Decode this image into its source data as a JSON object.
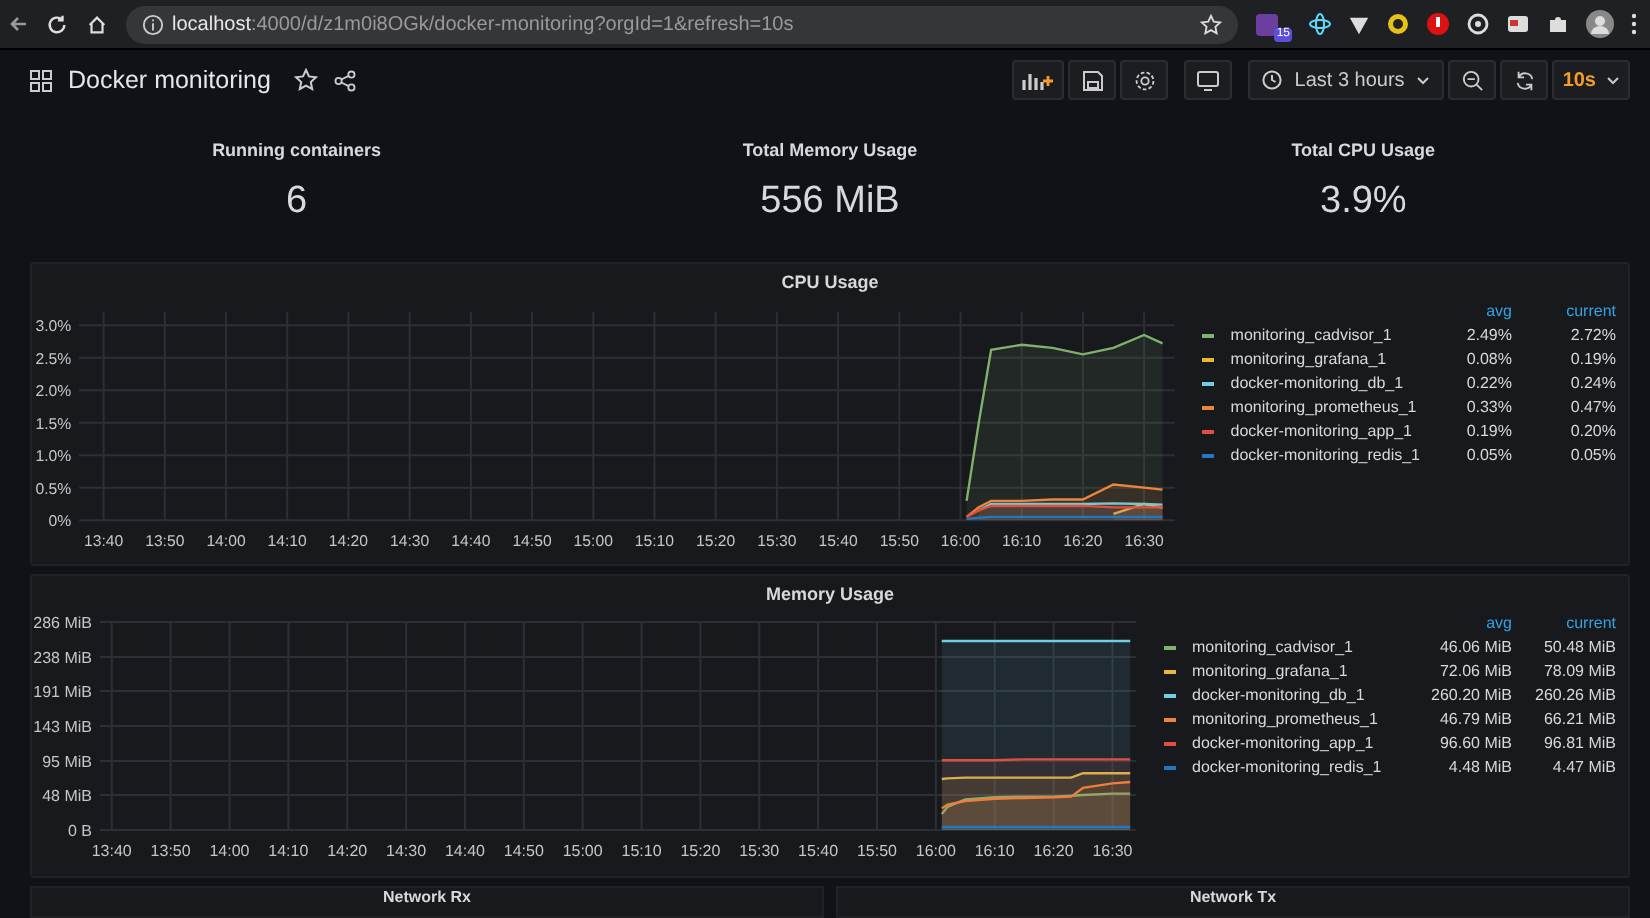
{
  "browser": {
    "url_host": "localhost",
    "url_path": ":4000/d/z1m0i8OGk/docker-monitoring?orgId=1&refresh=10s",
    "extension_badge": "15"
  },
  "dashboard": {
    "title": "Docker monitoring",
    "time_range": "Last 3 hours",
    "refresh": "10s"
  },
  "stats": [
    {
      "title": "Running containers",
      "value": "6"
    },
    {
      "title": "Total Memory Usage",
      "value": "556 MiB"
    },
    {
      "title": "Total CPU Usage",
      "value": "3.9%"
    }
  ],
  "panels": [
    {
      "title": "CPU Usage",
      "legend_columns": [
        "avg",
        "current"
      ],
      "legend": [
        {
          "avg": "2.49%",
          "current": "2.72%"
        },
        {
          "avg": "0.08%",
          "current": "0.19%"
        },
        {
          "avg": "0.22%",
          "current": "0.24%"
        },
        {
          "avg": "0.33%",
          "current": "0.47%"
        },
        {
          "avg": "0.19%",
          "current": "0.20%"
        },
        {
          "avg": "0.05%",
          "current": "0.05%"
        }
      ],
      "chart_data": {
        "type": "area",
        "grid": true,
        "x": [
          961,
          963,
          965,
          970,
          975,
          980,
          985,
          990,
          993
        ],
        "xlim": [
          816,
          995
        ],
        "ylim": [
          0,
          3.2
        ],
        "xticks": [
          {
            "value": 820,
            "label": "13:40"
          },
          {
            "value": 830,
            "label": "13:50"
          },
          {
            "value": 840,
            "label": "14:00"
          },
          {
            "value": 850,
            "label": "14:10"
          },
          {
            "value": 860,
            "label": "14:20"
          },
          {
            "value": 870,
            "label": "14:30"
          },
          {
            "value": 880,
            "label": "14:40"
          },
          {
            "value": 890,
            "label": "14:50"
          },
          {
            "value": 900,
            "label": "15:00"
          },
          {
            "value": 910,
            "label": "15:10"
          },
          {
            "value": 920,
            "label": "15:20"
          },
          {
            "value": 930,
            "label": "15:30"
          },
          {
            "value": 940,
            "label": "15:40"
          },
          {
            "value": 950,
            "label": "15:50"
          },
          {
            "value": 960,
            "label": "16:00"
          },
          {
            "value": 970,
            "label": "16:10"
          },
          {
            "value": 980,
            "label": "16:20"
          },
          {
            "value": 990,
            "label": "16:30"
          }
        ],
        "yticks": [
          {
            "value": 0,
            "label": "0%"
          },
          {
            "value": 0.5,
            "label": "0.5%"
          },
          {
            "value": 1,
            "label": "1.0%"
          },
          {
            "value": 1.5,
            "label": "1.5%"
          },
          {
            "value": 2,
            "label": "2.0%"
          },
          {
            "value": 2.5,
            "label": "2.5%"
          },
          {
            "value": 3,
            "label": "3.0%"
          }
        ],
        "series": [
          {
            "name": "monitoring_cadvisor_1",
            "color": "#7eb26d",
            "values": [
              0.3,
              1.5,
              2.62,
              2.7,
              2.65,
              2.55,
              2.65,
              2.85,
              2.72
            ]
          },
          {
            "name": "monitoring_grafana_1",
            "color": "#eab839",
            "values": [
              null,
              null,
              null,
              null,
              null,
              null,
              0.1,
              0.25,
              0.19
            ]
          },
          {
            "name": "docker-monitoring_db_1",
            "color": "#6ed0e0",
            "values": [
              null,
              0.15,
              0.25,
              0.25,
              0.25,
              0.25,
              0.26,
              0.25,
              0.24
            ]
          },
          {
            "name": "monitoring_prometheus_1",
            "color": "#ef843c",
            "values": [
              0.05,
              0.2,
              0.3,
              0.3,
              0.32,
              0.32,
              0.55,
              0.5,
              0.47
            ]
          },
          {
            "name": "docker-monitoring_app_1",
            "color": "#e24d42",
            "values": [
              0.05,
              0.15,
              0.22,
              0.22,
              0.22,
              0.22,
              0.2,
              0.2,
              0.2
            ]
          },
          {
            "name": "docker-monitoring_redis_1",
            "color": "#1f78c1",
            "values": [
              0.02,
              0.04,
              0.05,
              0.05,
              0.05,
              0.05,
              0.05,
              0.05,
              0.05
            ]
          }
        ]
      }
    },
    {
      "title": "Memory Usage",
      "legend_columns": [
        "avg",
        "current"
      ],
      "legend": [
        {
          "avg": "46.06 MiB",
          "current": "50.48 MiB"
        },
        {
          "avg": "72.06 MiB",
          "current": "78.09 MiB"
        },
        {
          "avg": "260.20 MiB",
          "current": "260.26 MiB"
        },
        {
          "avg": "46.79 MiB",
          "current": "66.21 MiB"
        },
        {
          "avg": "96.60 MiB",
          "current": "96.81 MiB"
        },
        {
          "avg": "4.48 MiB",
          "current": "4.47 MiB"
        }
      ],
      "chart_data": {
        "type": "area",
        "grid": true,
        "x": [
          961,
          962,
          965,
          970,
          975,
          980,
          983,
          985,
          990,
          993
        ],
        "xlim": [
          818,
          994
        ],
        "ylim": [
          0,
          286
        ],
        "xticks": [
          {
            "value": 820,
            "label": "13:40"
          },
          {
            "value": 830,
            "label": "13:50"
          },
          {
            "value": 840,
            "label": "14:00"
          },
          {
            "value": 850,
            "label": "14:10"
          },
          {
            "value": 860,
            "label": "14:20"
          },
          {
            "value": 870,
            "label": "14:30"
          },
          {
            "value": 880,
            "label": "14:40"
          },
          {
            "value": 890,
            "label": "14:50"
          },
          {
            "value": 900,
            "label": "15:00"
          },
          {
            "value": 910,
            "label": "15:10"
          },
          {
            "value": 920,
            "label": "15:20"
          },
          {
            "value": 930,
            "label": "15:30"
          },
          {
            "value": 940,
            "label": "15:40"
          },
          {
            "value": 950,
            "label": "15:50"
          },
          {
            "value": 960,
            "label": "16:00"
          },
          {
            "value": 970,
            "label": "16:10"
          },
          {
            "value": 980,
            "label": "16:20"
          },
          {
            "value": 990,
            "label": "16:30"
          }
        ],
        "yticks": [
          {
            "value": 0,
            "label": "0 B"
          },
          {
            "value": 48,
            "label": "48 MiB"
          },
          {
            "value": 95,
            "label": "95 MiB"
          },
          {
            "value": 143,
            "label": "143 MiB"
          },
          {
            "value": 191,
            "label": "191 MiB"
          },
          {
            "value": 238,
            "label": "238 MiB"
          },
          {
            "value": 286,
            "label": "286 MiB"
          }
        ],
        "series": [
          {
            "name": "monitoring_cadvisor_1",
            "color": "#7eb26d",
            "values": [
              22,
              32,
              42,
              45,
              46,
              46,
              47,
              48,
              50,
              50
            ]
          },
          {
            "name": "monitoring_grafana_1",
            "color": "#eab839",
            "values": [
              70,
              71,
              72,
              72,
              72,
              72,
              72,
              78,
              78,
              78
            ]
          },
          {
            "name": "docker-monitoring_db_1",
            "color": "#6ed0e0",
            "values": [
              260,
              260,
              260,
              260,
              260,
              260,
              260,
              260,
              260,
              260
            ]
          },
          {
            "name": "monitoring_prometheus_1",
            "color": "#ef843c",
            "values": [
              30,
              35,
              40,
              43,
              44,
              45,
              46,
              58,
              64,
              66
            ]
          },
          {
            "name": "docker-monitoring_app_1",
            "color": "#e24d42",
            "values": [
              96,
              96,
              96,
              96,
              97,
              97,
              97,
              97,
              97,
              97
            ]
          },
          {
            "name": "docker-monitoring_redis_1",
            "color": "#1f78c1",
            "values": [
              4,
              4,
              4,
              4,
              4,
              4,
              4,
              4,
              4,
              4
            ]
          }
        ]
      }
    }
  ],
  "bottom_panels": [
    {
      "title": "Network Rx"
    },
    {
      "title": "Network Tx"
    }
  ]
}
